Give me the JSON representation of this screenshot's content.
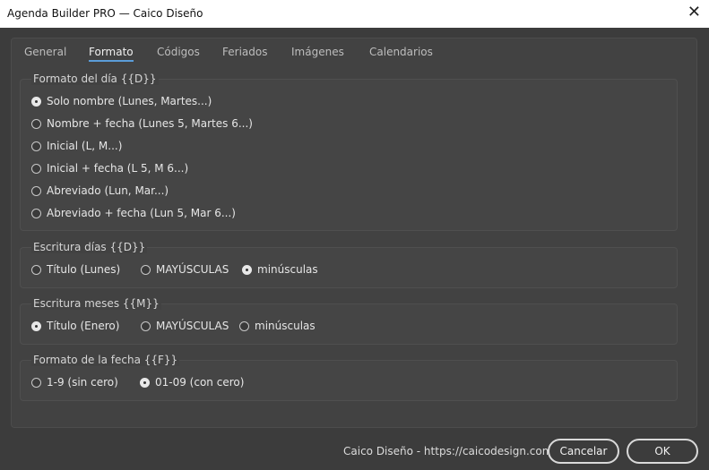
{
  "window": {
    "title": "Agenda Builder PRO — Caico Diseño",
    "close_glyph": "✕"
  },
  "tabs": [
    {
      "label": "General"
    },
    {
      "label": "Formato"
    },
    {
      "label": "Códigos"
    },
    {
      "label": "Feriados"
    },
    {
      "label": "Imágenes"
    },
    {
      "label": "Calendarios"
    }
  ],
  "active_tab": "Formato",
  "day_format": {
    "title": "Formato del día  {{D}}",
    "options": [
      {
        "label": "Solo nombre  (Lunes, Martes...)",
        "selected": true
      },
      {
        "label": "Nombre + fecha  (Lunes 5, Martes 6...)",
        "selected": false
      },
      {
        "label": "Inicial  (L, M...)",
        "selected": false
      },
      {
        "label": "Inicial + fecha  (L 5, M 6...)",
        "selected": false
      },
      {
        "label": "Abreviado  (Lun, Mar...)",
        "selected": false
      },
      {
        "label": "Abreviado + fecha  (Lun 5, Mar 6...)",
        "selected": false
      }
    ]
  },
  "day_case": {
    "title": "Escritura días  {{D}}",
    "options": [
      {
        "label": "Título  (Lunes)",
        "selected": false
      },
      {
        "label": "MAYÚSCULAS",
        "selected": false
      },
      {
        "label": "minúsculas",
        "selected": true
      }
    ]
  },
  "month_case": {
    "title": "Escritura meses  {{M}}",
    "options": [
      {
        "label": "Título  (Enero)",
        "selected": true
      },
      {
        "label": "MAYÚSCULAS",
        "selected": false
      },
      {
        "label": "minúsculas",
        "selected": false
      }
    ]
  },
  "date_format": {
    "title": "Formato de la fecha  {{F}}",
    "options": [
      {
        "label": "1-9  (sin cero)",
        "selected": false
      },
      {
        "label": "01-09  (con cero)",
        "selected": true
      }
    ]
  },
  "footer": {
    "link_text": "Caico Diseño - https://caicodesign.com",
    "cancel_label": "Cancelar",
    "ok_label": "OK"
  }
}
